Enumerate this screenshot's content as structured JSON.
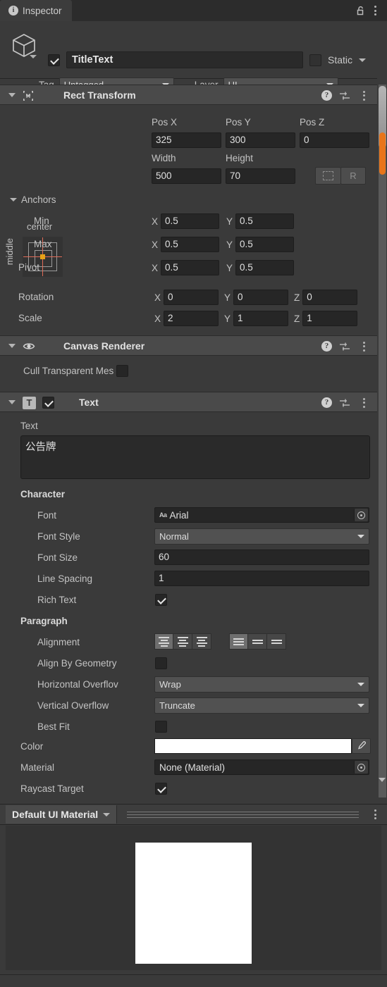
{
  "window": {
    "tab_label": "Inspector",
    "tab_icon": "info-icon",
    "lock_icon": "lock-icon",
    "menu_icon": "kebab-menu-icon"
  },
  "object_header": {
    "enabled": true,
    "name": "TitleText",
    "static_label": "Static",
    "static_checked": false,
    "tag_label": "Tag",
    "tag_value": "Untagged",
    "layer_label": "Layer",
    "layer_value": "UI"
  },
  "rect_transform": {
    "title": "Rect Transform",
    "anchor_preset": {
      "horizontal": "center",
      "vertical": "middle"
    },
    "pos_x_label": "Pos X",
    "pos_x": "325",
    "pos_y_label": "Pos Y",
    "pos_y": "300",
    "pos_z_label": "Pos Z",
    "pos_z": "0",
    "width_label": "Width",
    "width": "500",
    "height_label": "Height",
    "height": "70",
    "blueprint_button": "blueprint-mode",
    "raw_button": "R",
    "anchors_label": "Anchors",
    "min_label": "Min",
    "min_x": "0.5",
    "min_y": "0.5",
    "max_label": "Max",
    "max_x": "0.5",
    "max_y": "0.5",
    "pivot_label": "Pivot",
    "pivot_x": "0.5",
    "pivot_y": "0.5",
    "rotation_label": "Rotation",
    "rot_x": "0",
    "rot_y": "0",
    "rot_z": "0",
    "scale_label": "Scale",
    "scale_x": "2",
    "scale_y": "1",
    "scale_z": "1",
    "axis_x": "X",
    "axis_y": "Y",
    "axis_z": "Z"
  },
  "canvas_renderer": {
    "title": "Canvas Renderer",
    "cull_label": "Cull Transparent Mes",
    "cull_checked": false
  },
  "text_component": {
    "title": "Text",
    "enabled": true,
    "text_label": "Text",
    "text_value": "公告牌",
    "character_label": "Character",
    "font_label": "Font",
    "font_value": "Arial",
    "font_style_label": "Font Style",
    "font_style_value": "Normal",
    "font_size_label": "Font Size",
    "font_size_value": "60",
    "line_spacing_label": "Line Spacing",
    "line_spacing_value": "1",
    "rich_text_label": "Rich Text",
    "rich_text_checked": true,
    "paragraph_label": "Paragraph",
    "alignment_label": "Alignment",
    "alignment_h_selected": 0,
    "alignment_v_selected": 0,
    "align_geometry_label": "Align By Geometry",
    "align_geometry_checked": false,
    "h_overflow_label": "Horizontal Overflov",
    "h_overflow_value": "Wrap",
    "v_overflow_label": "Vertical Overflow",
    "v_overflow_value": "Truncate",
    "best_fit_label": "Best Fit",
    "best_fit_checked": false,
    "color_label": "Color",
    "color_value": "#FFFFFF",
    "material_label": "Material",
    "material_value": "None (Material)",
    "raycast_label": "Raycast Target",
    "raycast_checked": true
  },
  "material_footer": {
    "name": "Default UI Material"
  },
  "colors": {
    "background": "#3a3a3a",
    "header": "#4a4a4a",
    "field": "#262626",
    "dropdown": "#515151",
    "accent_orange": "#e8751a",
    "anchor_red": "#e06c58",
    "pivot_yellow": "#e8a117"
  }
}
